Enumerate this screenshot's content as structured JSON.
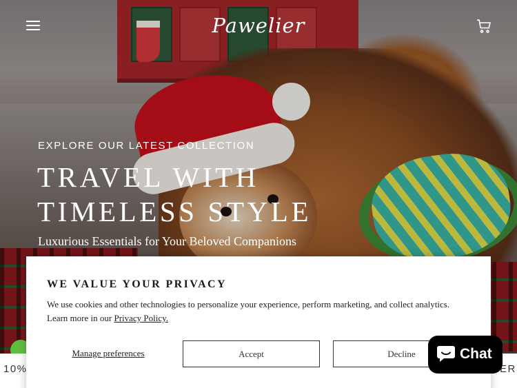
{
  "header": {
    "logo": "Pawelier",
    "menu_icon": "hamburger-menu-icon",
    "cart_icon": "shopping-cart-icon"
  },
  "hero": {
    "eyebrow": "EXPLORE OUR LATEST COLLECTION",
    "headline_line1": "TRAVEL WITH",
    "headline_line2": "TIMELESS STYLE",
    "subline": "Luxurious Essentials for Your Beloved Companions"
  },
  "ticker": {
    "left_text": "10%",
    "right_text": "ERS"
  },
  "privacy": {
    "title": "WE VALUE YOUR PRIVACY",
    "text_before_link": "We use cookies and other technologies to personalize your experience, perform marketing, and collect analytics. Learn more in our ",
    "link_text": "Privacy Policy.",
    "manage_label": "Manage preferences",
    "accept_label": "Accept",
    "decline_label": "Decline"
  },
  "chat": {
    "label": "Chat",
    "icon": "chat-bubble-icon",
    "brand_color": "#000000"
  }
}
